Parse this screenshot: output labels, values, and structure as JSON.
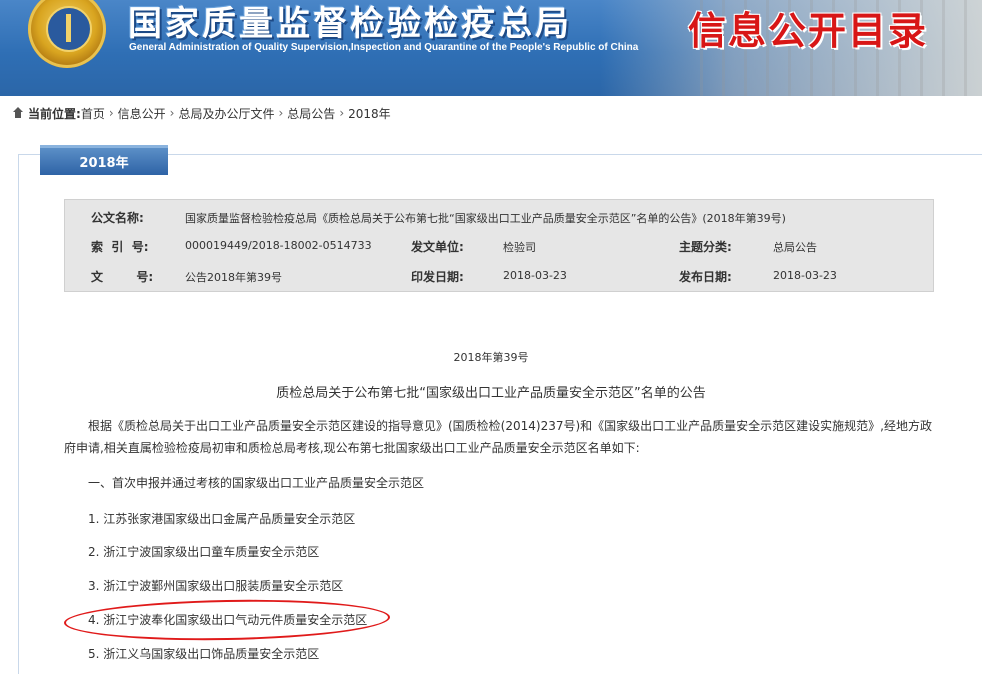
{
  "header": {
    "title": "国家质量监督检验检疫总局",
    "subtitle": "General Administration of Quality Supervision,Inspection and Quarantine of the People's Republic of China",
    "tag": "信息公开目录",
    "colors": {
      "banner": "#2f6fb5",
      "tag": "#d81616"
    }
  },
  "breadcrumb": {
    "label": "当前位置:",
    "items": [
      "首页",
      "信息公开",
      "总局及办公厅文件",
      "总局公告",
      "2018年"
    ]
  },
  "year_tab": "2018年",
  "meta": {
    "doc_name_label": "公文名称:",
    "doc_name": "国家质量监督检验检疫总局《质检总局关于公布第七批“国家级出口工业产品质量安全示范区”名单的公告》(2018年第39号)",
    "index_label": "索  引  号:",
    "index": "000019449/2018-18002-0514733",
    "issuer_label": "发文单位:",
    "issuer": "检验司",
    "topic_label": "主题分类:",
    "topic": "总局公告",
    "docno_label": "文        号:",
    "docno": "公告2018年第39号",
    "print_date_label": "印发日期:",
    "print_date": "2018-03-23",
    "publish_date_label": "发布日期:",
    "publish_date": "2018-03-23"
  },
  "article": {
    "doc_no": "2018年第39号",
    "title": "质检总局关于公布第七批“国家级出口工业产品质量安全示范区”名单的公告",
    "paragraph": "根据《质检总局关于出口工业产品质量安全示范区建设的指导意见》(国质检检(2014)237号)和《国家级出口工业产品质量安全示范区建设实施规范》,经地方政府申请,相关直属检验检疫局初审和质检总局考核,现公布第七批国家级出口工业产品质量安全示范区名单如下:",
    "section": "一、首次申报并通过考核的国家级出口工业产品质量安全示范区",
    "items": [
      "1. 江苏张家港国家级出口金属产品质量安全示范区",
      "2. 浙江宁波国家级出口童车质量安全示范区",
      "3. 浙江宁波鄞州国家级出口服装质量安全示范区",
      "4. 浙江宁波奉化国家级出口气动元件质量安全示范区",
      "5. 浙江义乌国家级出口饰品质量安全示范区"
    ]
  }
}
